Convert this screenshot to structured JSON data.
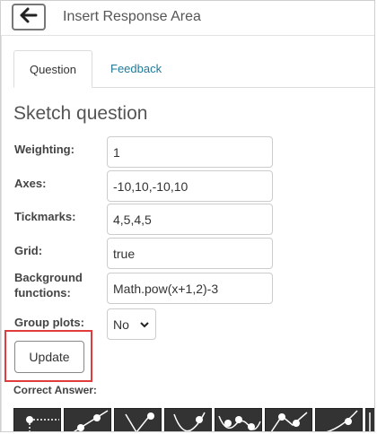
{
  "header": {
    "title": "Insert Response Area",
    "back_icon": "arrow-left-icon"
  },
  "tabs": [
    {
      "label": "Question",
      "active": true
    },
    {
      "label": "Feedback",
      "active": false
    }
  ],
  "section_title": "Sketch question",
  "form": {
    "weighting": {
      "label": "Weighting:",
      "value": "1"
    },
    "axes": {
      "label": "Axes:",
      "value": "-10,10,-10,10"
    },
    "tickmarks": {
      "label": "Tickmarks:",
      "value": "4,5,4,5"
    },
    "grid": {
      "label": "Grid:",
      "value": "true"
    },
    "background_functions": {
      "label": "Background functions:",
      "value": "Math.pow(x+1,2)-3"
    },
    "group_plots": {
      "label": "Group plots:",
      "value": "No"
    }
  },
  "update_button": "Update",
  "correct_answer_label": "Correct Answer:",
  "toolbar": {
    "icons": [
      "horizontal-line-tool-icon",
      "line-tool-icon",
      "v-shape-tool-icon",
      "curve-tool-icon",
      "wave-tool-icon",
      "peak-tool-icon",
      "rising-curve-tool-icon",
      "more-tool-icon"
    ]
  },
  "colors": {
    "accent_link": "#1f7a9a",
    "highlight": "#e03c3c",
    "tool_bg": "#333333"
  }
}
